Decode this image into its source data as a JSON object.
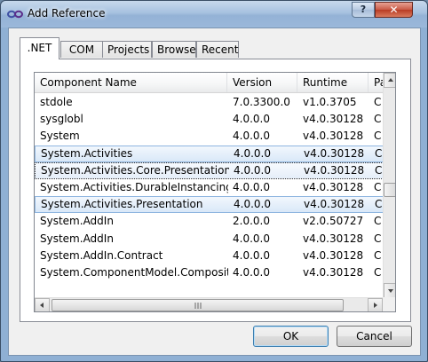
{
  "window": {
    "title": "Add Reference",
    "help_label": "?",
    "close_label": "✕"
  },
  "tabs": [
    {
      "label": ".NET",
      "active": true
    },
    {
      "label": "COM",
      "active": false
    },
    {
      "label": "Projects",
      "active": false
    },
    {
      "label": "Browse",
      "active": false
    },
    {
      "label": "Recent",
      "active": false
    }
  ],
  "list": {
    "columns": [
      "Component Name",
      "Version",
      "Runtime",
      "Pa"
    ],
    "rows": [
      {
        "name": "stdole",
        "version": "7.0.3300.0",
        "runtime": "v1.0.3705",
        "path": "C"
      },
      {
        "name": "sysglobl",
        "version": "4.0.0.0",
        "runtime": "v4.0.30128",
        "path": "C"
      },
      {
        "name": "System",
        "version": "4.0.0.0",
        "runtime": "v4.0.30128",
        "path": "C"
      },
      {
        "name": "System.Activities",
        "version": "4.0.0.0",
        "runtime": "v4.0.30128",
        "path": "C",
        "state": "sel"
      },
      {
        "name": "System.Activities.Core.Presentation",
        "version": "4.0.0.0",
        "runtime": "v4.0.30128",
        "path": "C",
        "state": "focus"
      },
      {
        "name": "System.Activities.DurableInstancing",
        "version": "4.0.0.0",
        "runtime": "v4.0.30128",
        "path": "C"
      },
      {
        "name": "System.Activities.Presentation",
        "version": "4.0.0.0",
        "runtime": "v4.0.30128",
        "path": "C",
        "state": "sel"
      },
      {
        "name": "System.AddIn",
        "version": "2.0.0.0",
        "runtime": "v2.0.50727",
        "path": "C"
      },
      {
        "name": "System.AddIn",
        "version": "4.0.0.0",
        "runtime": "v4.0.30128",
        "path": "C"
      },
      {
        "name": "System.AddIn.Contract",
        "version": "4.0.0.0",
        "runtime": "v4.0.30128",
        "path": "C"
      },
      {
        "name": "System.ComponentModel.Compositi...",
        "version": "4.0.0.0",
        "runtime": "v4.0.30128",
        "path": "C"
      }
    ]
  },
  "buttons": {
    "ok": "OK",
    "cancel": "Cancel"
  }
}
